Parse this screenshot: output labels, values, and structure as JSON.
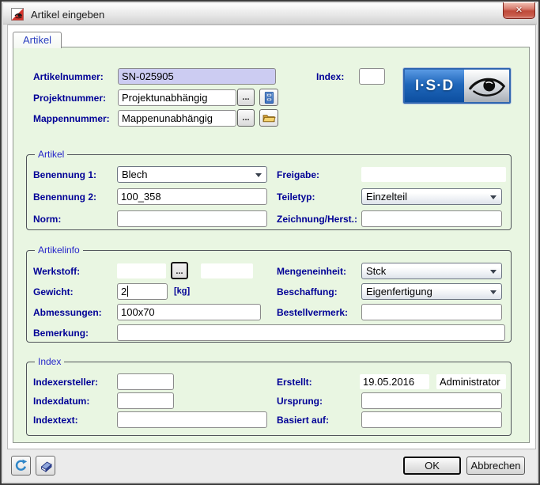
{
  "window": {
    "title": "Artikel eingeben"
  },
  "ui": {
    "browse_label": "...",
    "close_glyph": "✕"
  },
  "tab": {
    "label": "Artikel"
  },
  "header": {
    "artikelnummer": {
      "label": "Artikelnummer:",
      "value": "SN-025905"
    },
    "index": {
      "label": "Index:",
      "value": ""
    },
    "projektnummer": {
      "label": "Projektnummer:",
      "value": "Projektunabhängig"
    },
    "mappennummer": {
      "label": "Mappennummer:",
      "value": "Mappenunabhängig"
    },
    "logo_text": "I·S·D"
  },
  "artikel": {
    "title": "Artikel",
    "benennung1": {
      "label": "Benennung 1:",
      "value": "Blech"
    },
    "benennung2": {
      "label": "Benennung 2:",
      "value": "100_358"
    },
    "norm": {
      "label": "Norm:",
      "value": ""
    },
    "freigabe": {
      "label": "Freigabe:",
      "value": ""
    },
    "teiletyp": {
      "label": "Teiletyp:",
      "value": "Einzelteil"
    },
    "zeichnung_herst": {
      "label": "Zeichnung/Herst.:",
      "value": ""
    }
  },
  "artikelinfo": {
    "title": "Artikelinfo",
    "werkstoff": {
      "label": "Werkstoff:",
      "value": "",
      "value2": ""
    },
    "gewicht": {
      "label": "Gewicht:",
      "value": "2",
      "unit": "[kg]"
    },
    "abmessungen": {
      "label": "Abmessungen:",
      "value": "100x70"
    },
    "bemerkung": {
      "label": "Bemerkung:",
      "value": ""
    },
    "mengeneinheit": {
      "label": "Mengeneinheit:",
      "value": "Stck"
    },
    "beschaffung": {
      "label": "Beschaffung:",
      "value": "Eigenfertigung"
    },
    "bestellvermerk": {
      "label": "Bestellvermerk:",
      "value": ""
    }
  },
  "index_group": {
    "title": "Index",
    "indexersteller": {
      "label": "Indexersteller:",
      "value": ""
    },
    "indexdatum": {
      "label": "Indexdatum:",
      "value": ""
    },
    "indextext": {
      "label": "Indextext:",
      "value": ""
    },
    "erstellt": {
      "label": "Erstellt:",
      "date": "19.05.2016",
      "user": "Administrator"
    },
    "ursprung": {
      "label": "Ursprung:",
      "value": ""
    },
    "basiert_auf": {
      "label": "Basiert auf:",
      "value": ""
    }
  },
  "footer": {
    "ok": "OK",
    "cancel": "Abbrechen"
  },
  "colors": {
    "panel_background": "#e9f6e2",
    "label_text": "#000096",
    "artikelnummer_background": "#ccccf2",
    "logo_blue": "#1963b8",
    "close_button_red": "#bf4a3b"
  }
}
